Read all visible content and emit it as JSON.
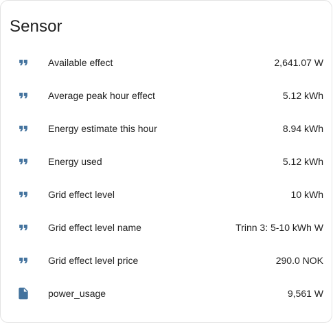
{
  "card": {
    "title": "Sensor"
  },
  "entities": [
    {
      "name": "Available effect",
      "value": "2,641.07 W",
      "icon": "format-quote-close-icon"
    },
    {
      "name": "Average peak hour effect",
      "value": "5.12 kWh",
      "icon": "format-quote-close-icon"
    },
    {
      "name": "Energy estimate this hour",
      "value": "8.94 kWh",
      "icon": "format-quote-close-icon"
    },
    {
      "name": "Energy used",
      "value": "5.12 kWh",
      "icon": "format-quote-close-icon"
    },
    {
      "name": "Grid effect level",
      "value": "10 kWh",
      "icon": "format-quote-close-icon"
    },
    {
      "name": "Grid effect level name",
      "value": "Trinn 3: 5-10 kWh W",
      "icon": "format-quote-close-icon"
    },
    {
      "name": "Grid effect level price",
      "value": "290.0 NOK",
      "icon": "format-quote-close-icon"
    },
    {
      "name": "power_usage",
      "value": "9,561 W",
      "icon": "file-icon"
    }
  ],
  "colors": {
    "icon": "#44739e",
    "text": "#212121",
    "card_border": "#e3e3e3",
    "background": "#ffffff"
  }
}
